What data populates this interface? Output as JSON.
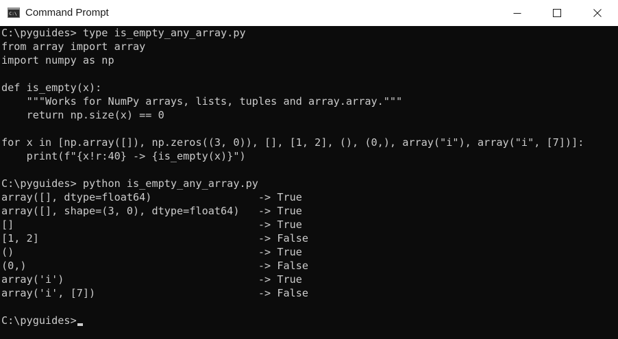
{
  "window": {
    "title": "Command Prompt",
    "icon": "command-prompt-icon",
    "controls": {
      "minimize": "minimize-icon",
      "maximize": "maximize-icon",
      "close": "close-icon"
    }
  },
  "terminal": {
    "lines": [
      "C:\\pyguides> type is_empty_any_array.py",
      "from array import array",
      "import numpy as np",
      "",
      "def is_empty(x):",
      "    \"\"\"Works for NumPy arrays, lists, tuples and array.array.\"\"\"",
      "    return np.size(x) == 0",
      "",
      "for x in [np.array([]), np.zeros((3, 0)), [], [1, 2], (), (0,), array(\"i\"), array(\"i\", [7])]:",
      "    print(f\"{x!r:40} -> {is_empty(x)}\")",
      "",
      "C:\\pyguides> python is_empty_any_array.py",
      "array([], dtype=float64)                 -> True",
      "array([], shape=(3, 0), dtype=float64)   -> True",
      "[]                                       -> True",
      "[1, 2]                                   -> False",
      "()                                       -> True",
      "(0,)                                     -> False",
      "array('i')                               -> True",
      "array('i', [7])                          -> False",
      ""
    ],
    "prompt": "C:\\pyguides>"
  }
}
